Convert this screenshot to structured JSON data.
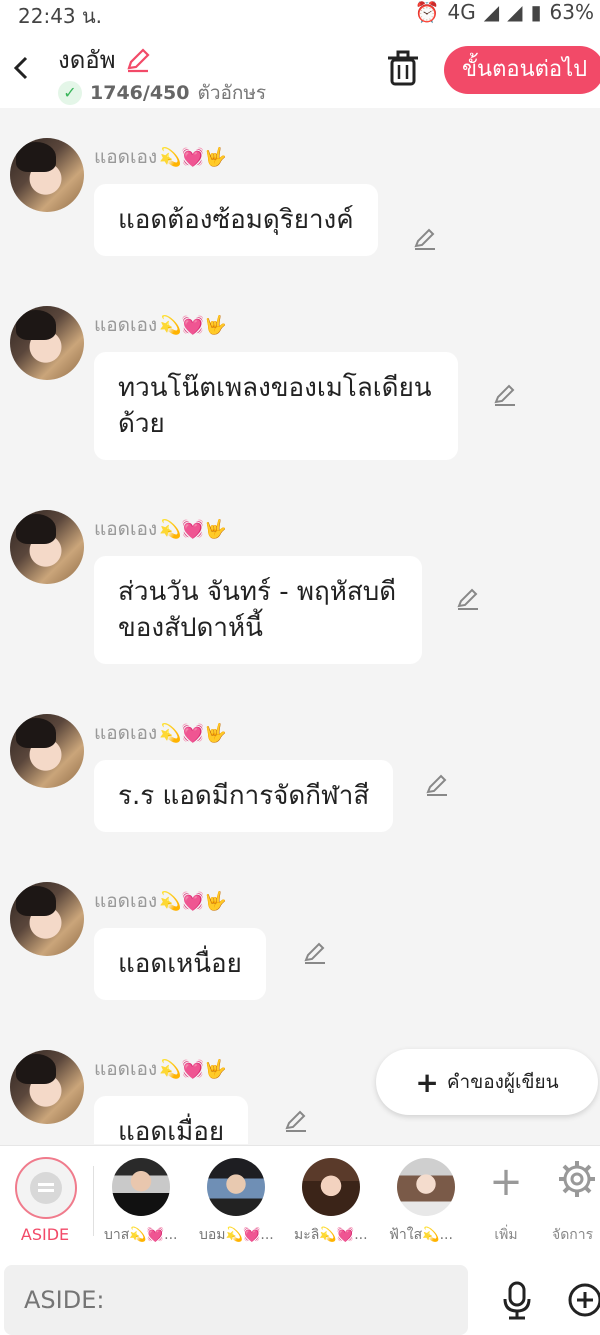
{
  "status_bar": {
    "time": "22:43 น.",
    "network": "4G",
    "battery": "63%"
  },
  "header": {
    "title": "งดอัพ",
    "char_count": "1746/450",
    "char_unit": "ตัวอักษร",
    "next_label": "ขั้นตอนต่อไป"
  },
  "sender_name": "แอดเอง",
  "sender_emojis": "💫💓🤟",
  "messages": [
    {
      "text": "แอดต้องซ้อมดุริยางค์"
    },
    {
      "text": "ทวนโน๊ตเพลงของเมโลเดียน ด้วย"
    },
    {
      "text": "ส่วนวัน จันทร์ - พฤหัสบดี ของสัปดาห์นี้"
    },
    {
      "text": "ร.ร แอดมีการจัดกีฬาสี"
    },
    {
      "text": "แอดเหนื่อย"
    },
    {
      "text": "แอดเมื่อย"
    }
  ],
  "fab_label": "คำของผู้เขียน",
  "charbar": {
    "aside_label": "ASIDE",
    "characters": [
      {
        "name": "บาส💫💓..."
      },
      {
        "name": "บอม💫💓..."
      },
      {
        "name": "มะลิ💫💓..."
      },
      {
        "name": "ฟ้าใส💫..."
      }
    ],
    "add_label": "เพิ่ม",
    "settings_label": "จัดการ"
  },
  "input": {
    "placeholder": "ASIDE:"
  }
}
